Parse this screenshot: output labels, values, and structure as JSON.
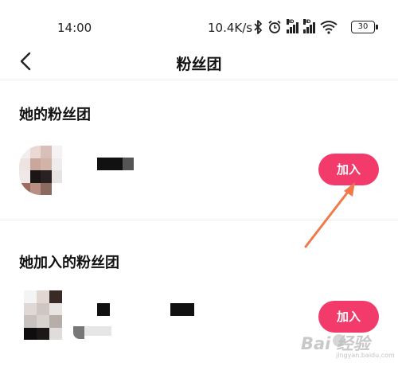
{
  "status_bar": {
    "time": "14:00",
    "net_speed": "10.4K/s",
    "battery": "30",
    "icons": [
      "bluetooth-icon",
      "alarm-icon",
      "hd-signal-icon",
      "hd-signal-icon",
      "wifi-icon",
      "battery-icon"
    ]
  },
  "nav": {
    "back_icon": "chevron-left-icon",
    "title": "粉丝团"
  },
  "her_fan_club": {
    "section_title": "她的粉丝团",
    "join_label": "加入"
  },
  "joined_fan_clubs": {
    "section_title": "她加入的粉丝团",
    "join_label": "加入"
  },
  "watermark": {
    "text": "Bai 经验",
    "sub": "jingyan.baidu.com"
  },
  "colors": {
    "accent": "#f23b6a",
    "annotation_arrow": "#f07a4a"
  }
}
